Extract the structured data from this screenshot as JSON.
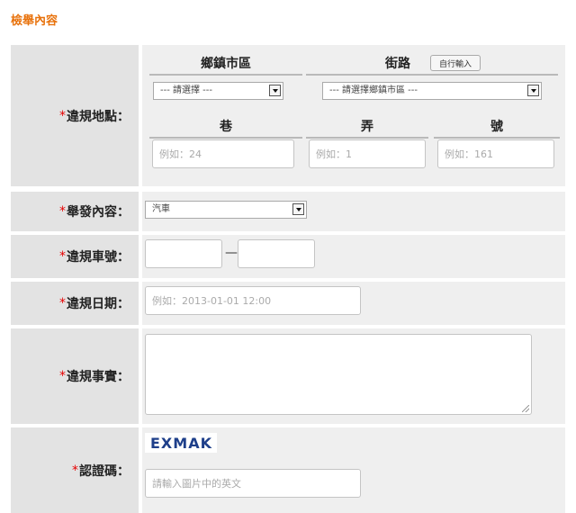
{
  "page_title": "檢舉內容",
  "required_mark": "*",
  "location": {
    "label": "違規地點：",
    "district_header": "鄉鎮市區",
    "street_header": "街路",
    "manual_input_button": "自行輸入",
    "district_select_value": "--- 請選擇 ---",
    "street_select_value": "--- 請選擇鄉鎮市區 ---",
    "lane_header": "巷",
    "alley_header": "弄",
    "number_header": "號",
    "lane_placeholder": "例如：24",
    "alley_placeholder": "例如：1",
    "number_placeholder": "例如：161"
  },
  "report_content": {
    "label": "舉發內容：",
    "select_value": "汽車"
  },
  "plate": {
    "label": "違規車號：",
    "separator": "—"
  },
  "date": {
    "label": "違規日期：",
    "placeholder": "例如：2013-01-01 12:00"
  },
  "facts": {
    "label": "違規事實："
  },
  "captcha": {
    "label": "認證碼：",
    "image_text": "EXMAK",
    "placeholder": "請輸入圖片中的英文"
  }
}
